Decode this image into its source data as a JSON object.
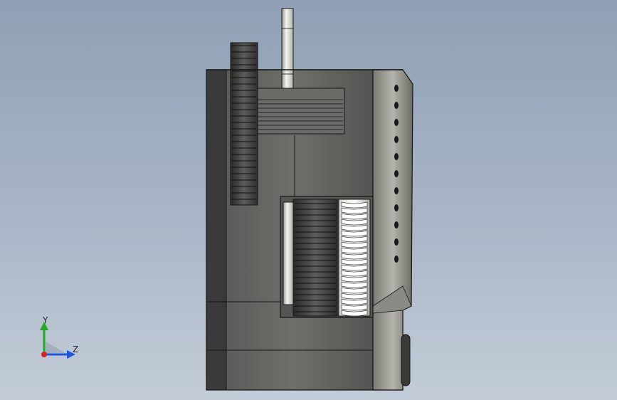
{
  "viewport": {
    "background_top": "#8fa0b6",
    "background_bottom": "#c3ccd8"
  },
  "model": {
    "body_color": "#4a4a4a",
    "body_highlight": "#8c8c88",
    "edge_color": "#151515",
    "gear_color": "#3c3c3c",
    "shaft_color": "#f2f2ee"
  },
  "triad": {
    "y_label": "Y",
    "z_label": "Z",
    "y_color": "#22aa22",
    "z_color": "#2255dd",
    "x_color": "#dd2222"
  }
}
